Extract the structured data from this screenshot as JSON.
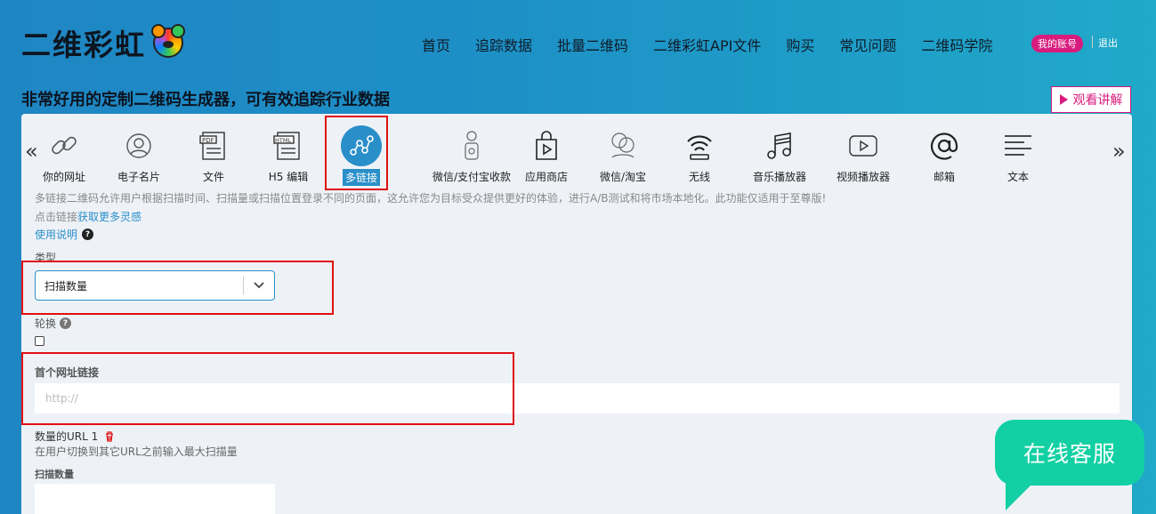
{
  "header": {
    "logo_text": "二维彩虹",
    "nav": [
      "首页",
      "追踪数据",
      "批量二维码",
      "二维彩虹API文件",
      "购买",
      "常见问题",
      "二维码学院"
    ],
    "account_label": "我的账号",
    "logout_label": "退出"
  },
  "tagline": "非常好用的定制二维码生成器，可有效追踪行业数据",
  "watch_button": "观看讲解",
  "type_tabs": [
    {
      "label": "你的网址",
      "icon": "link-icon"
    },
    {
      "label": "电子名片",
      "icon": "person-icon"
    },
    {
      "label": "文件",
      "icon": "pdf-icon"
    },
    {
      "label": "H5 编辑",
      "icon": "html-icon"
    },
    {
      "label": "多链接",
      "icon": "multi-link-icon",
      "active": true
    },
    {
      "label": "微信/支付宝收款",
      "icon": "payment-icon"
    },
    {
      "label": "应用商店",
      "icon": "app-store-icon"
    },
    {
      "label": "微信/淘宝",
      "icon": "wechat-icon"
    },
    {
      "label": "无线",
      "icon": "wifi-icon"
    },
    {
      "label": "音乐播放器",
      "icon": "music-icon"
    },
    {
      "label": "视频播放器",
      "icon": "video-icon"
    },
    {
      "label": "邮箱",
      "icon": "email-icon"
    },
    {
      "label": "文本",
      "icon": "text-icon"
    }
  ],
  "nav_arrows": {
    "prev": "«",
    "next": "»"
  },
  "description": "多链接二维码允许用户根据扫描时间、扫描量或扫描位置登录不同的页面，这允许您为目标受众提供更好的体验，进行A/B测试和将市场本地化。此功能仅适用于至尊版!",
  "inspiration": {
    "prefix": "点击链接",
    "link": "获取更多灵感"
  },
  "howto_label": "使用说明",
  "form": {
    "type_label": "类型",
    "type_value": "扫描数量",
    "rotate_label": "轮换",
    "first_url_label": "首个网址链接",
    "first_url_placeholder": "http://",
    "url1_label": "数量的URL 1",
    "url1_hint": "在用户切换到其它URL之前输入最大扫描量",
    "scan_count_label": "扫描数量"
  },
  "chat_label": "在线客服",
  "colors": {
    "accent": "#2a8fc9",
    "brand_pink": "#d81b7d",
    "chat_green": "#12d0a3",
    "highlight_red": "#e01010"
  }
}
